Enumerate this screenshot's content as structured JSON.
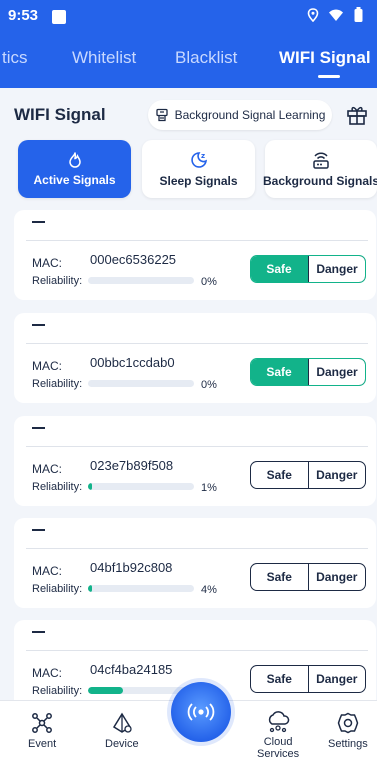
{
  "status_bar": {
    "time": "9:53",
    "icons": [
      "location-icon",
      "wifi-icon",
      "battery-icon"
    ]
  },
  "tabs": [
    {
      "label": "tics",
      "active": false
    },
    {
      "label": "Whitelist",
      "active": false
    },
    {
      "label": "Blacklist",
      "active": false
    },
    {
      "label": "WIFI Signal",
      "active": true
    }
  ],
  "section": {
    "title": "WIFI Signal",
    "learning_button": "Background Signal Learning"
  },
  "segments": [
    {
      "label": "Active Signals",
      "icon": "flame-icon",
      "active": true
    },
    {
      "label": "Sleep Signals",
      "icon": "moon-icon",
      "active": false
    },
    {
      "label": "Background Signals",
      "icon": "router-icon",
      "active": false
    }
  ],
  "labels": {
    "mac": "MAC:",
    "reliability": "Reliability:",
    "safe": "Safe",
    "danger": "Danger",
    "name_placeholder": "—"
  },
  "signals": [
    {
      "name": "—",
      "mac": "000ec6536225",
      "reliability": "0%",
      "reliability_fraction": 0.0,
      "safe_selected": true
    },
    {
      "name": "—",
      "mac": "00bbc1ccdab0",
      "reliability": "0%",
      "reliability_fraction": 0.0,
      "safe_selected": true
    },
    {
      "name": "—",
      "mac": "023e7b89f508",
      "reliability": "1%",
      "reliability_fraction": 0.01,
      "safe_selected": false
    },
    {
      "name": "—",
      "mac": "04bf1b92c808",
      "reliability": "4%",
      "reliability_fraction": 0.04,
      "safe_selected": false
    },
    {
      "name": "—",
      "mac": "04cf4ba24185",
      "reliability": "",
      "reliability_fraction": 0.33,
      "safe_selected": false
    }
  ],
  "bottom_nav": [
    {
      "label": "Event",
      "icon": "event-icon"
    },
    {
      "label": "Device",
      "icon": "device-icon"
    },
    {
      "label": "",
      "icon": "signal-broadcast-icon"
    },
    {
      "label": "Cloud\nServices",
      "icon": "cloud-icon"
    },
    {
      "label": "Settings",
      "icon": "gear-icon"
    }
  ],
  "colors": {
    "primary": "#2563ea",
    "safe_green": "#12b38a",
    "text": "#1d2a44",
    "background": "#f2f5fa"
  }
}
